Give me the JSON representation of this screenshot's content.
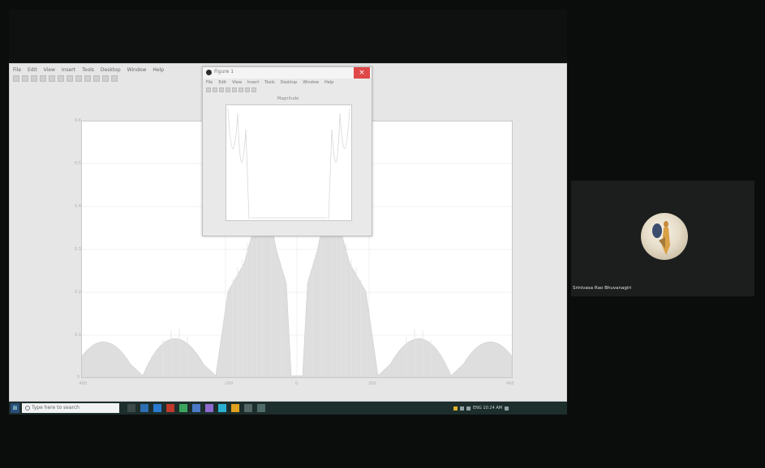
{
  "main_window": {
    "menu_items": [
      "File",
      "Edit",
      "View",
      "Insert",
      "Tools",
      "Desktop",
      "Window",
      "Help"
    ],
    "y_ticks": [
      "0.6",
      "0.5",
      "0.4",
      "0.3",
      "0.2",
      "0.1",
      "0"
    ],
    "x_ticks": [
      "-400",
      "-200",
      "0",
      "200",
      "400"
    ]
  },
  "popup": {
    "title": "Figure 1",
    "close_label": "×",
    "menu_items": [
      "File",
      "Edit",
      "View",
      "Insert",
      "Tools",
      "Desktop",
      "Window",
      "Help"
    ],
    "axes_title": "Magnitude"
  },
  "taskbar": {
    "start_label": "⊞",
    "search_placeholder": "Type here to search",
    "tray_text": "ENG  10:24 AM"
  },
  "participant": {
    "name": "Srinivasa Rao Bhuvanagiri"
  },
  "colors": {
    "background": "#0b0d0c",
    "taskbar": "#1d2e2c",
    "popup_close": "#e04848"
  }
}
